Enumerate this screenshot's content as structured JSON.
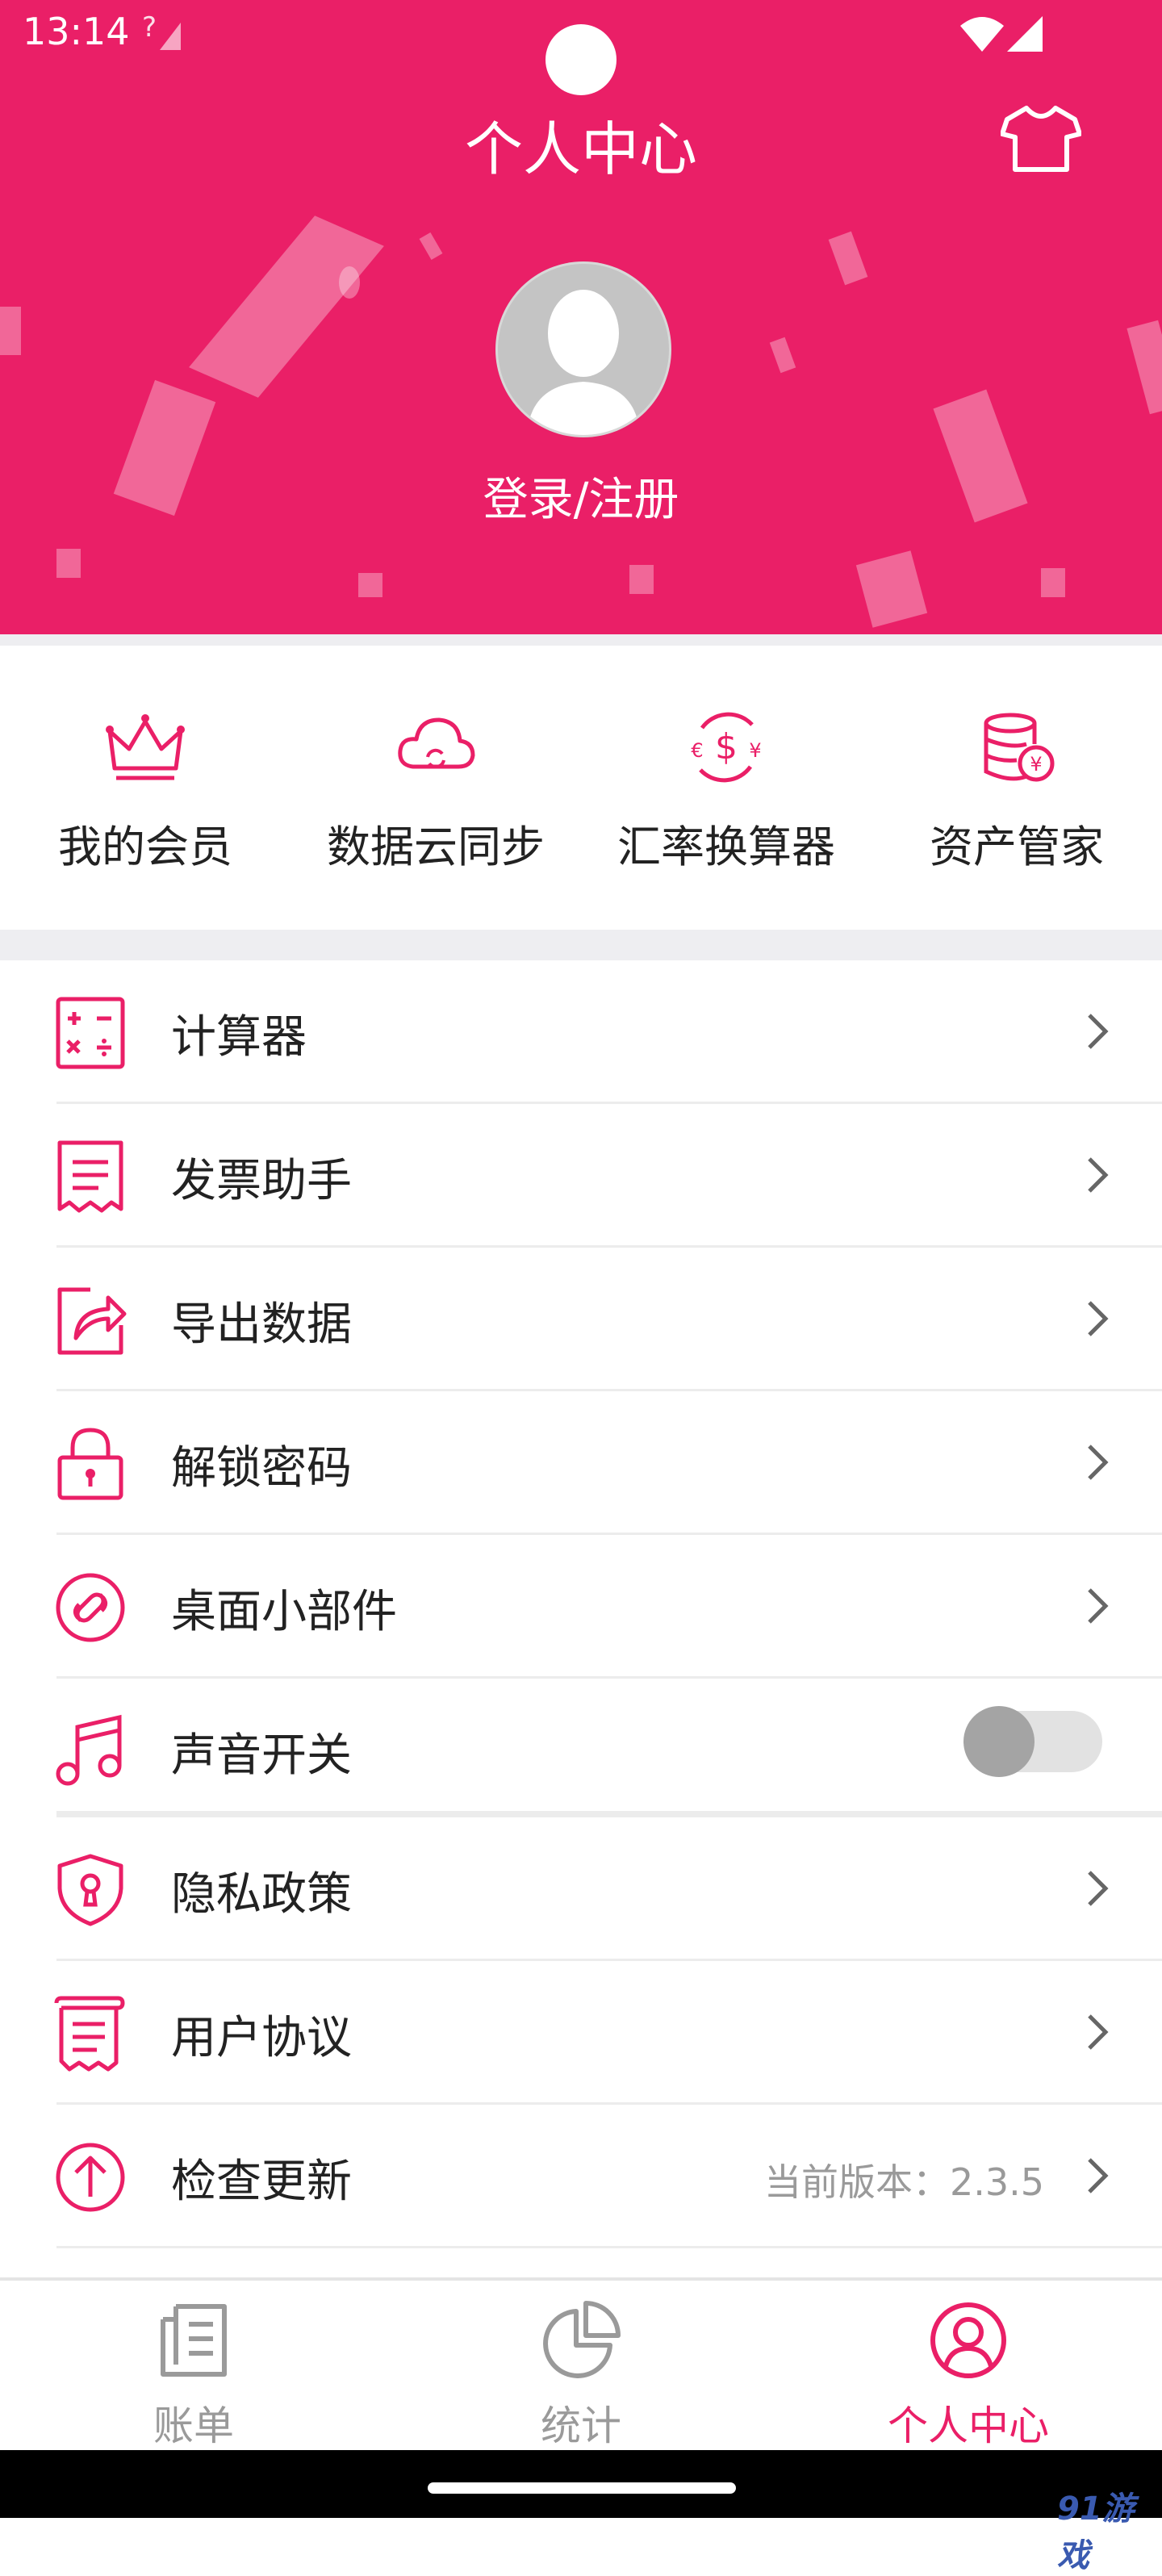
{
  "status_bar": {
    "time": "13:14",
    "signal_note": "?"
  },
  "header": {
    "title": "个人中心",
    "login_label": "登录/注册"
  },
  "quick_actions": [
    {
      "label": "我的会员",
      "icon": "crown-icon"
    },
    {
      "label": "数据云同步",
      "icon": "cloud-sync-icon"
    },
    {
      "label": "汇率换算器",
      "icon": "currency-exchange-icon"
    },
    {
      "label": "资产管家",
      "icon": "coins-icon"
    }
  ],
  "menu": [
    {
      "label": "计算器",
      "icon": "calculator-icon"
    },
    {
      "label": "发票助手",
      "icon": "receipt-icon"
    },
    {
      "label": "导出数据",
      "icon": "export-icon"
    },
    {
      "label": "解锁密码",
      "icon": "lock-icon"
    },
    {
      "label": "桌面小部件",
      "icon": "widget-link-icon"
    },
    {
      "label": "声音开关",
      "icon": "music-note-icon",
      "toggle": false
    },
    {
      "label": "隐私政策",
      "icon": "shield-icon"
    },
    {
      "label": "用户协议",
      "icon": "document-icon"
    },
    {
      "label": "检查更新",
      "icon": "upload-arrow-icon",
      "extra": "当前版本：2.3.5"
    }
  ],
  "bottom_nav": [
    {
      "label": "账单",
      "icon": "bill-icon",
      "active": false
    },
    {
      "label": "统计",
      "icon": "pie-chart-icon",
      "active": false
    },
    {
      "label": "个人中心",
      "icon": "user-circle-icon",
      "active": true
    }
  ],
  "watermark": "91游戏",
  "colors": {
    "accent": "#ea1f67",
    "inactive": "#9a9a9a",
    "divider": "#ececec"
  }
}
